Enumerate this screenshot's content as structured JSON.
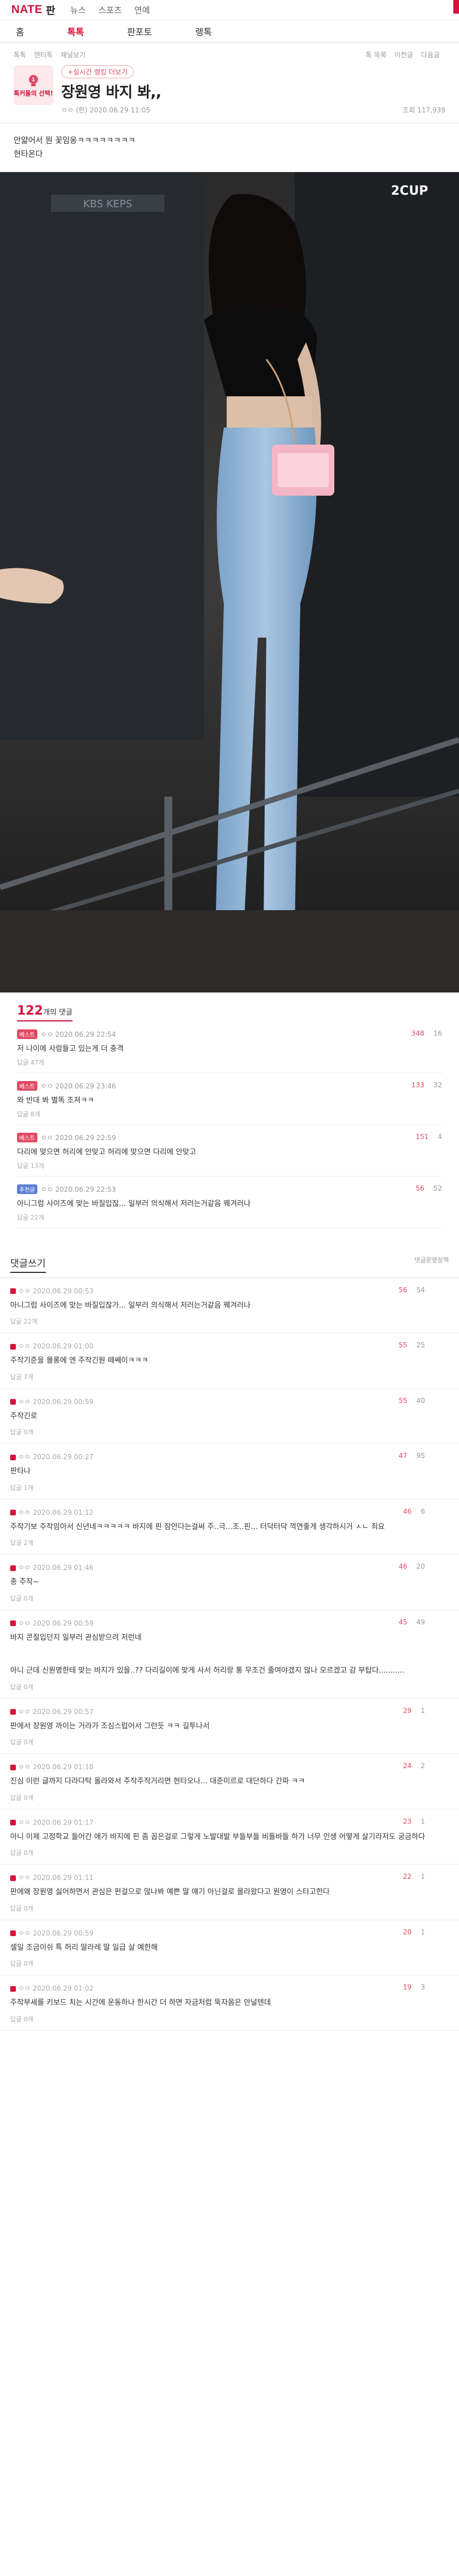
{
  "header": {
    "logo_text": "NATE",
    "logo_pan": "판",
    "nav": [
      "뉴스",
      "스포츠",
      "연예"
    ]
  },
  "catnav": [
    "홈",
    "톡톡",
    "판포토",
    "랭톡"
  ],
  "crumbs": {
    "left": [
      "톡톡",
      "엔터톡",
      "채널보기"
    ],
    "right": [
      "톡 목록",
      "이전글",
      "다음글"
    ]
  },
  "post": {
    "badge_text": "톡커들의 선택!",
    "hot_tag": "+실시간 랭킹 더보기",
    "title": "장원영 바지 봐,,",
    "author_date": "ㅇㅇ (판) 2020.06.29 11:05",
    "views": "조회 117,939",
    "body_line1": "안얇어서 뭔 꽃임옹ㅋㅋㅋㅋㅋㅋㅋㅋ",
    "body_line2": "현타온다",
    "photo_watermark": "2CUP"
  },
  "best": {
    "count": "122",
    "label": "개의 댓글",
    "items": [
      {
        "rank": "베스트",
        "date": "ㅇㅇ 2020.06.29 22:54",
        "text": "저 나이에 사람들고 있는게 더 충격",
        "reply": "답글 47개",
        "up": "348",
        "down": "16"
      },
      {
        "rank": "베스트",
        "date": "ㅇㅇ 2020.06.29 23:46",
        "text": "와 반대 봐 별똑 조져ㅋㅋ",
        "reply": "답글 8개",
        "up": "133",
        "down": "32"
      },
      {
        "rank": "베스트",
        "date": "ㅇㅇ 2020.06.29 22:59",
        "text": "다리에 맞으면 허리에 안맞고 허리에 맞으면 다리에 안맞고",
        "reply": "답글 13개",
        "up": "151",
        "down": "4"
      },
      {
        "rank": "추천글",
        "date": "ㅇㅇ 2020.06.29 22:53",
        "text": "아니그럼 사이즈에 맞는 바질입잖...  일부러 의식해서 저러는거같음 꿰겨러나",
        "reply": "답글 22개",
        "up": "56",
        "down": "52"
      }
    ]
  },
  "comments_header": {
    "title": "댓글쓰기",
    "right": "댓글운영정책"
  },
  "comments": [
    {
      "date": "ㅇㅇ 2020.06.29 00:53",
      "text": "아니그럼 사이즈에 맞는 바질입잖가... 일부러 의식해서 저러는거같음 꿰겨러나",
      "reply": "답글 22개",
      "up": "56",
      "down": "54"
    },
    {
      "date": "ㅇㅇ 2020.06.29 01:00",
      "text": "주작기준을 몰롱에 엔 주작긴원 떼쎄이ㅋㅋㅋ",
      "reply": "답글 7개",
      "up": "55",
      "down": "25"
    },
    {
      "date": "ㅇㅇ 2020.06.29 00:59",
      "text": "주작긴로",
      "reply": "답글 0개",
      "up": "55",
      "down": "40"
    },
    {
      "date": "ㅇㅇ 2020.06.29 00:27",
      "text": "판타나",
      "reply": "답글 1개",
      "up": "47",
      "down": "95"
    },
    {
      "date": "ㅇㅇ 2020.06.29 01:12",
      "text": "주작기보 주작임아서 신년네ㅋㅋㅋㅋㅋ 바지에 핀 잠안다는걸써 주..극...조..핀... 터닥터닥 꺽연좋게 생각하시거 ㅅㄴ 죄요",
      "reply": "답글 2개",
      "up": "46",
      "down": "6"
    },
    {
      "date": "ㅇㅇ 2020.06.29 01:46",
      "text": "총 주작~",
      "reply": "답글 0개",
      "up": "46",
      "down": "20"
    },
    {
      "date": "ㅇㅇ 2020.06.29 00:59",
      "text": "바지 콘절입던지 일부러 관심받으려 저런네\n\n\n아니 근데 신원명한테 맞는 바지가 있을..?? 다리길이에 맞게 사서 허리랑 통 무조건 줄여야겠지 않나 모르겠고 감 부탑다...........",
      "reply": "답글 0개",
      "up": "45",
      "down": "49"
    },
    {
      "date": "ㅇㅇ 2020.06.29 00:57",
      "text": "판에서 장원영 까이는 거라가 조심스럽어서 그런듯 ㅋㅋ 길투나서",
      "reply": "답글 0개",
      "up": "29",
      "down": "1"
    },
    {
      "date": "ㅇㅇ 2020.06.29 01:18",
      "text": "진심 이런 글까지 다라다탁 올라와서 주작주작거리면 현타오나... 대준미르로 대단하다 간파 ㅋㅋ",
      "reply": "답글 0개",
      "up": "24",
      "down": "2"
    },
    {
      "date": "ㅇㅇ 2020.06.29 01:17",
      "text": "아니 이제 고정학교 들어간 애가 바지에 핀 좀 꼽은걸로 그렇게 노발대발 부들부들 비틀바들 하가 너무 인생 어떻게 살기라저도 궁금하다",
      "reply": "답글 0개",
      "up": "23",
      "down": "1"
    },
    {
      "date": "ㅇㅇ 2020.06.29 01:11",
      "text": "판에왜 장원영 싫어하면서 관심은 펀걸으로 많나봐 예쁜 딸 얘기 아닌걸로 올라왔다고 원영이 스타고한다",
      "reply": "답글 0개",
      "up": "22",
      "down": "1"
    },
    {
      "date": "ㅇㅇ 2020.06.29 00:59",
      "text": "셀일 조금이쉬 특 허리 딸라레 딸 일급 살 예한해",
      "reply": "답글 0개",
      "up": "20",
      "down": "1"
    },
    {
      "date": "ㅇㅇ 2020.06.29 01:02",
      "text": "주작부세를 키보드 치는 시간에 운동하나 한시간 더 하면 자금처럼 뚝자몸은 안널텐데",
      "reply": "답글 0개",
      "up": "19",
      "down": "3"
    }
  ]
}
